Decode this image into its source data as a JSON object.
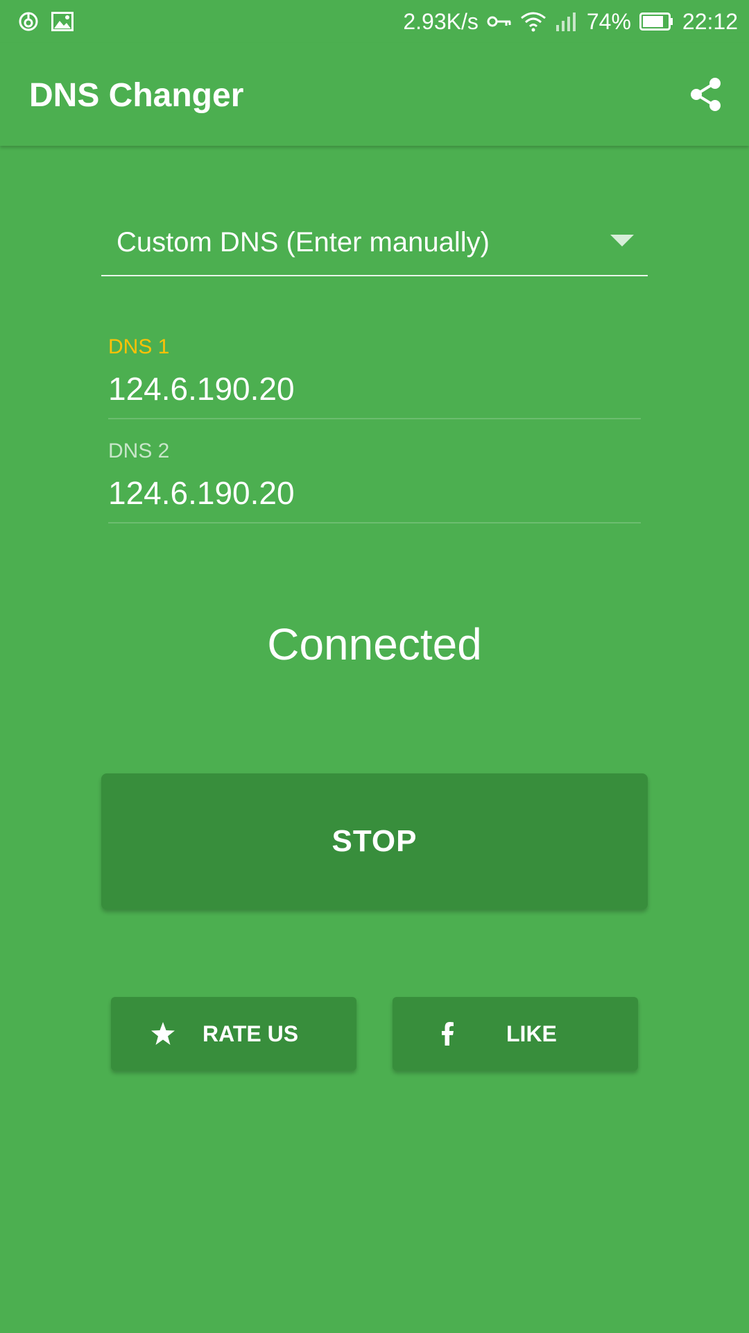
{
  "status_bar": {
    "network_speed": "2.93K/s",
    "battery": "74%",
    "time": "22:12",
    "icons": [
      "app-notification-icon",
      "image-icon",
      "vpn-key-icon",
      "wifi-icon",
      "signal-icon",
      "battery-icon"
    ]
  },
  "app_bar": {
    "title": "DNS Changer",
    "share_icon": "share-icon"
  },
  "dns_spinner": {
    "selected": "Custom DNS (Enter manually)"
  },
  "dns1": {
    "label": "DNS 1",
    "value": "124.6.190.20"
  },
  "dns2": {
    "label": "DNS 2",
    "value": "124.6.190.20"
  },
  "connection": {
    "status": "Connected"
  },
  "buttons": {
    "stop": "STOP",
    "rate": "RATE US",
    "like": "LIKE"
  },
  "colors": {
    "background": "#4caf50",
    "button": "#388e3c",
    "focused_label": "#ffc107"
  }
}
